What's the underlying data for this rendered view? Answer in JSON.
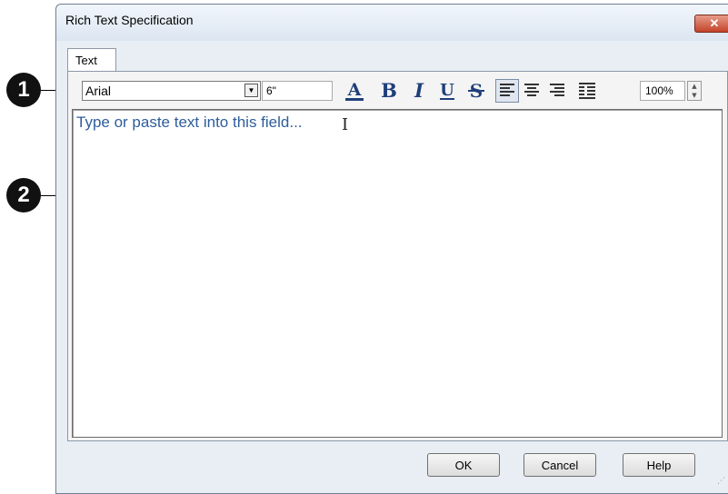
{
  "window": {
    "title": "Rich Text Specification",
    "close_label": "✕"
  },
  "tabs": [
    {
      "label": "Text"
    }
  ],
  "toolbar": {
    "font_name": "Arial",
    "font_size": "6\"",
    "zoom": "100%"
  },
  "editor": {
    "placeholder": "Type or paste text into this field..."
  },
  "footer": {
    "ok_label": "OK",
    "cancel_label": "Cancel",
    "help_label": "Help"
  },
  "callouts": [
    {
      "label": "1"
    },
    {
      "label": "2"
    }
  ]
}
